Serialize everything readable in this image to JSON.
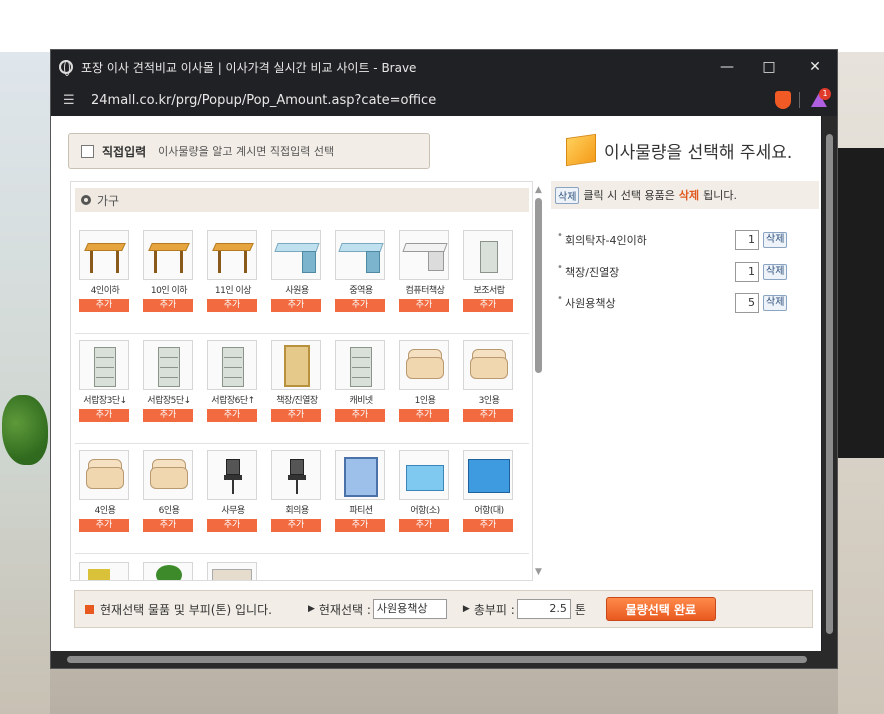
{
  "window": {
    "title": "포장 이사 견적비교 이사몰 | 이사가격 실시간 비교 사이트 - Brave",
    "url": "24mall.co.kr/prg/Popup/Pop_Amount.asp?cate=office",
    "notification_count": "1"
  },
  "direct_input": {
    "label": "직접입력",
    "description": "이사물량을 알고 계시면 직접입력 선택"
  },
  "header": {
    "title": "이사물량을 선택해 주세요."
  },
  "category": {
    "label": "가구"
  },
  "add_label": "추가",
  "rows": [
    [
      {
        "name": "4인이하",
        "icon": "table-icon"
      },
      {
        "name": "10인 이하",
        "icon": "table-icon"
      },
      {
        "name": "11인 이상",
        "icon": "table-icon"
      },
      {
        "name": "사원용",
        "icon": "desk-icon"
      },
      {
        "name": "중역용",
        "icon": "desk-icon"
      },
      {
        "name": "컴퓨터책상",
        "icon": "computer-desk-icon"
      },
      {
        "name": "보조서랍",
        "icon": "drawer-icon"
      }
    ],
    [
      {
        "name": "서랍장3단↓",
        "icon": "cabinet-icon"
      },
      {
        "name": "서랍장5단↓",
        "icon": "cabinet-icon"
      },
      {
        "name": "서랍장6단↑",
        "icon": "cabinet-icon"
      },
      {
        "name": "책장/진열장",
        "icon": "bookshelf-icon"
      },
      {
        "name": "캐비넷",
        "icon": "cabinet-icon"
      },
      {
        "name": "1인용",
        "icon": "sofa-icon"
      },
      {
        "name": "3인용",
        "icon": "sofa-icon"
      }
    ],
    [
      {
        "name": "4인용",
        "icon": "sofa-icon"
      },
      {
        "name": "6인용",
        "icon": "sofa-icon"
      },
      {
        "name": "사무용",
        "icon": "office-chair-icon"
      },
      {
        "name": "회의용",
        "icon": "meeting-chair-icon"
      },
      {
        "name": "파티션",
        "icon": "partition-icon"
      },
      {
        "name": "어항(소)",
        "icon": "fish-tank-small-icon"
      },
      {
        "name": "어항(대)",
        "icon": "fish-tank-large-icon"
      }
    ]
  ],
  "selection": {
    "delete_label": "삭제",
    "hint_mid": "클릭 시 선택 용품은",
    "hint_highlight": "삭제",
    "hint_end": "됩니다.",
    "items": [
      {
        "name": "회의탁자-4인이하",
        "qty": "1"
      },
      {
        "name": "책장/진열장",
        "qty": "1"
      },
      {
        "name": "사원용책상",
        "qty": "5"
      }
    ]
  },
  "bottom": {
    "message": "현재선택 물품 및 부피(톤) 입니다.",
    "current_label": "현재선택 :",
    "current_value": "사원용책상",
    "volume_label": "총부피 :",
    "volume_value": "2.5",
    "volume_unit": "톤",
    "done_label": "물량선택 완료"
  },
  "colors": {
    "accent": "#e8591f",
    "add_button": "#f26a3f"
  }
}
